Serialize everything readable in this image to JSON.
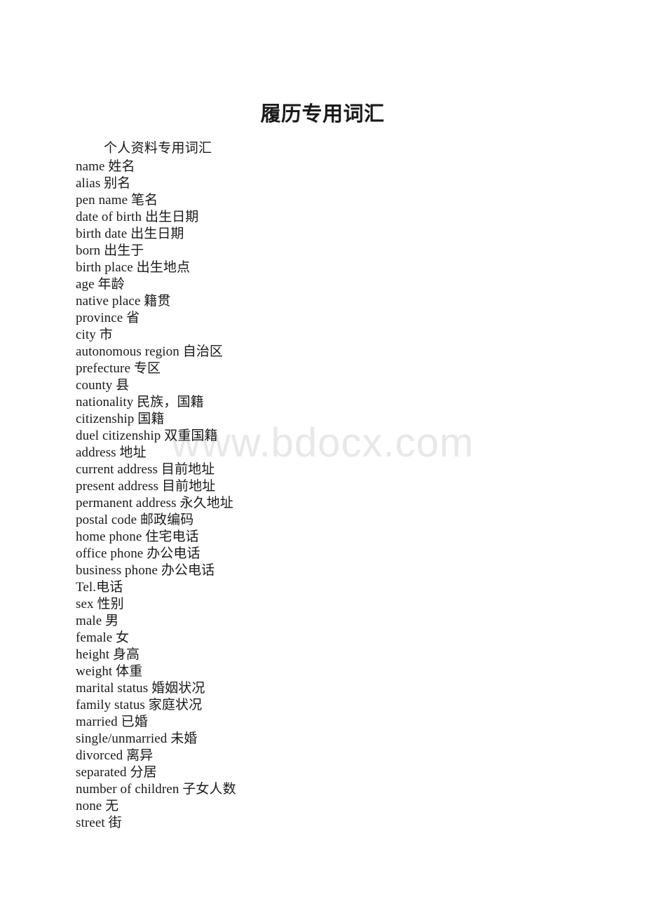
{
  "document": {
    "title": "履历专用词汇",
    "subtitle": "个人资料专用词汇",
    "watermark": "www.bdocx.com",
    "text_color": "#1a1a1a",
    "watermark_color": "#e8e8e8",
    "background_color": "#ffffff"
  },
  "vocabulary": [
    "name 姓名",
    "alias 别名",
    "pen name 笔名",
    "date of birth 出生日期",
    "birth date 出生日期",
    "born 出生于",
    "birth place 出生地点",
    "age 年龄",
    "native place 籍贯",
    "province 省",
    "city 市",
    "autonomous region 自治区",
    "prefecture 专区",
    "county 县",
    "nationality 民族，国籍",
    "citizenship 国籍",
    "duel citizenship 双重国籍",
    "address 地址",
    "current address 目前地址",
    "present address 目前地址",
    "permanent address 永久地址",
    "postal code 邮政编码",
    "home phone 住宅电话",
    "office phone 办公电话",
    "business phone 办公电话",
    "Tel.电话",
    "sex 性别",
    "male 男",
    "female 女",
    "height 身高",
    "weight 体重",
    "marital status 婚姻状况",
    "family status 家庭状况",
    "married 已婚",
    "single/unmarried 未婚",
    "divorced 离异",
    "separated 分居",
    "number of children 子女人数",
    "none 无",
    "street 街"
  ]
}
